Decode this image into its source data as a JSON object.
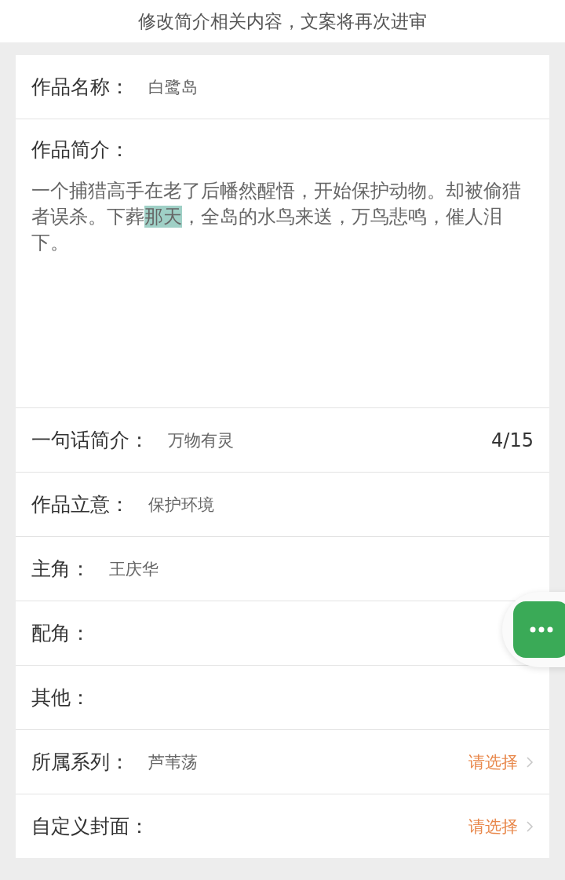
{
  "notice": "修改简介相关内容，文案将再次进审",
  "name_row": {
    "label": "作品名称：",
    "value": "白鹭岛"
  },
  "description": {
    "label": "作品简介：",
    "segments": [
      {
        "text": "一个捕猎高手在老了后幡然醒悟，开始保护动物。却被偷猎者误杀。下葬",
        "highlighted": false
      },
      {
        "text": "那天",
        "highlighted": true
      },
      {
        "text": "，全岛的水鸟来送，万鸟悲鸣，催人泪下。",
        "highlighted": false
      }
    ]
  },
  "rows": [
    {
      "kind": "counter",
      "label": "一句话简介：",
      "value": "万物有灵",
      "count": "4/15"
    },
    {
      "kind": "text",
      "label": "作品立意：",
      "value": "保护环境"
    },
    {
      "kind": "text",
      "label": "主角：",
      "value": "王庆华"
    },
    {
      "kind": "text",
      "label": "配角："
    },
    {
      "kind": "text",
      "label": "其他："
    },
    {
      "kind": "select",
      "label": "所属系列：",
      "value": "芦苇荡",
      "action": "请选择"
    },
    {
      "kind": "select",
      "label": "自定义封面：",
      "action": "请选择"
    }
  ]
}
